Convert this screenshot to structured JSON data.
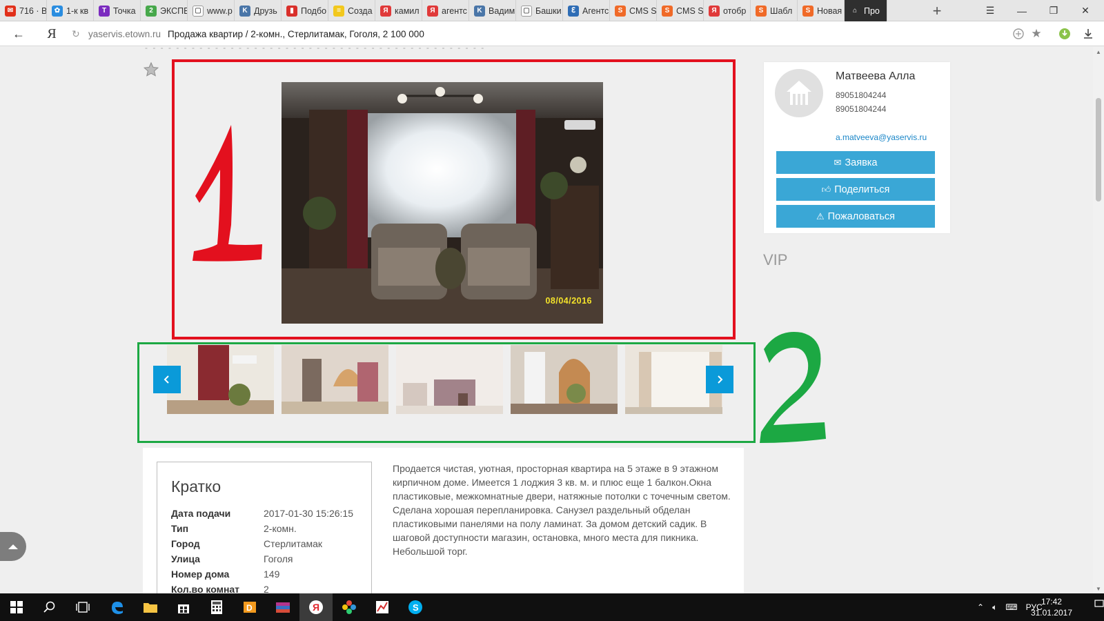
{
  "browser": {
    "tabs": [
      {
        "label": "716 · В",
        "color": "#e1301a",
        "glyph": "✉"
      },
      {
        "label": "1-к кв",
        "color": "#2a8de0",
        "glyph": "✿"
      },
      {
        "label": "Точка",
        "color": "#7b2cbf",
        "glyph": "T"
      },
      {
        "label": "ЭКСПЕ",
        "color": "#47a84b",
        "glyph": "2"
      },
      {
        "label": "www.p",
        "color": "#ffffff",
        "glyph": "▢"
      },
      {
        "label": "Друзь",
        "color": "#4a76a8",
        "glyph": "K"
      },
      {
        "label": "Подбо",
        "color": "#d9302b",
        "glyph": "▮"
      },
      {
        "label": "Созда",
        "color": "#f2c81d",
        "glyph": "="
      },
      {
        "label": "камил",
        "color": "#e03a3a",
        "glyph": "Я"
      },
      {
        "label": "агентс",
        "color": "#e03a3a",
        "glyph": "Я"
      },
      {
        "label": "Вадим",
        "color": "#4a76a8",
        "glyph": "K"
      },
      {
        "label": "Башки",
        "color": "#ffffff",
        "glyph": "▢"
      },
      {
        "label": "Агентс",
        "color": "#2f6db5",
        "glyph": "ℇ"
      },
      {
        "label": "CMS S",
        "color": "#f06a28",
        "glyph": "S"
      },
      {
        "label": "CMS S",
        "color": "#f06a28",
        "glyph": "S"
      },
      {
        "label": "отобр",
        "color": "#e03a3a",
        "glyph": "Я"
      },
      {
        "label": "Шабл",
        "color": "#f06a28",
        "glyph": "S"
      },
      {
        "label": "Новая",
        "color": "#f06a28",
        "glyph": "S"
      },
      {
        "label": "Про",
        "color": "#2f2f2f",
        "glyph": "⌂"
      }
    ],
    "new_tab": "+",
    "yandex_logo": "Я",
    "domain": "yaservis.etown.ru",
    "page_title": "Продажа квартир / 2-комн., Стерлитамак, Гоголя, 2 100 000"
  },
  "gallery": {
    "photo_date": "08/04/2016",
    "thumbnails": [
      "thumb-1",
      "thumb-2",
      "thumb-3",
      "thumb-4",
      "thumb-5"
    ]
  },
  "annotations": {
    "one": "1",
    "two": "2"
  },
  "agent": {
    "name": "Матвеева Алла",
    "phone1": "89051804244",
    "phone2": "89051804244",
    "email": "a.matveeva@yaservis.ru",
    "buttons": {
      "request": "Заявка",
      "share": "Поделиться",
      "complain": "Пожаловаться"
    }
  },
  "vip_label": "VIP",
  "brief": {
    "title": "Кратко",
    "rows": [
      {
        "key": "Дата подачи",
        "value": "2017-01-30 15:26:15"
      },
      {
        "key": "Тип",
        "value": "2-комн."
      },
      {
        "key": "Город",
        "value": "Стерлитамак"
      },
      {
        "key": "Улица",
        "value": "Гоголя"
      },
      {
        "key": "Номер дома",
        "value": "149"
      },
      {
        "key": "Кол.во комнат",
        "value": "2"
      }
    ]
  },
  "description": "Продается чистая, уютная, просторная квартира на 5 этаже в 9 этажном кирпичном доме. Имеется 1 лоджия 3 кв. м. и плюс еще 1 балкон.Окна пластиковые, межкомнатные двери, натяжные потолки с точечным светом. Сделана хорошая перепланировка. Санузел раздельный обделан пластиковыми панелями на полу ламинат. За домом детский садик. В шаговой доступности магазин, остановка, много места для пикника. Небольшой торг.",
  "taskbar": {
    "language": "РУС",
    "time": "17:42",
    "date": "31.01.2017"
  }
}
